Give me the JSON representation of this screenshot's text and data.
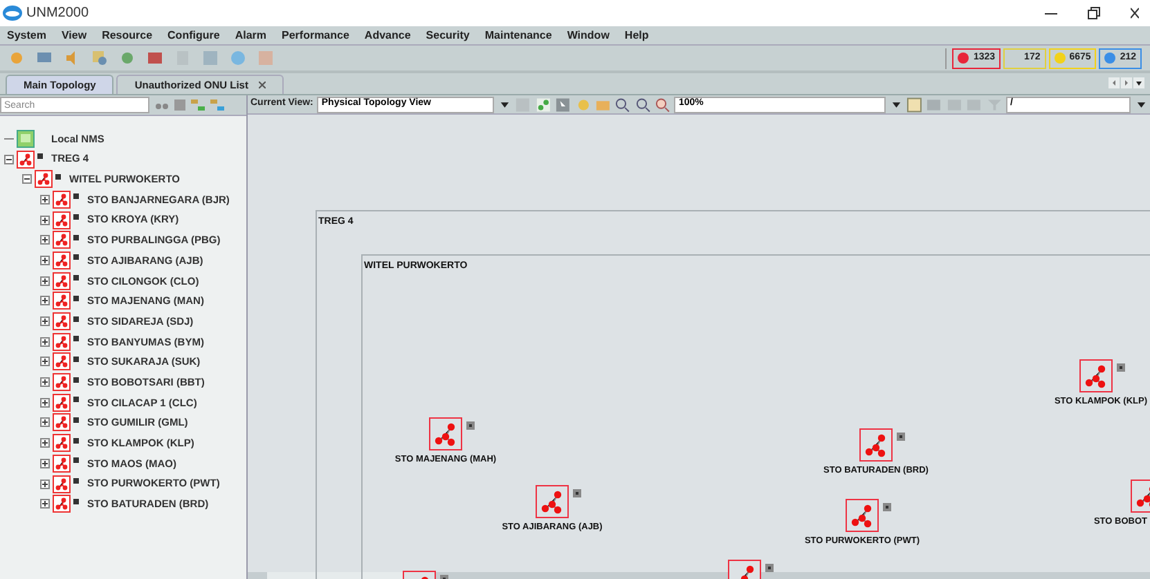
{
  "window": {
    "title": "UNM2000"
  },
  "menu": [
    "System",
    "View",
    "Resource",
    "Configure",
    "Alarm",
    "Performance",
    "Advance",
    "Security",
    "Maintenance",
    "Window",
    "Help"
  ],
  "alarm_counters": [
    {
      "count": "1323",
      "color": "#e8253a"
    },
    {
      "count": "172",
      "color": "#e0d040"
    },
    {
      "count": "6675",
      "color": "#f2d21a"
    },
    {
      "count": "212",
      "color": "#3a8ee6"
    }
  ],
  "tabs": [
    {
      "label": "Main Topology",
      "selected": true,
      "closable": false
    },
    {
      "label": "Unauthorized ONU List",
      "selected": false,
      "closable": true
    }
  ],
  "search": {
    "placeholder": "Search"
  },
  "tree": [
    {
      "label": "Local NMS",
      "kind": "nms"
    },
    {
      "label": "TREG 4",
      "kind": "group",
      "expanded": true,
      "children": [
        {
          "label": "WITEL PURWOKERTO",
          "kind": "group",
          "expanded": true,
          "children": [
            {
              "label": "STO BANJARNEGARA (BJR)",
              "kind": "group",
              "expanded": false
            },
            {
              "label": "STO KROYA (KRY)",
              "kind": "group",
              "expanded": false
            },
            {
              "label": "STO PURBALINGGA (PBG)",
              "kind": "group",
              "expanded": false
            },
            {
              "label": "STO AJIBARANG (AJB)",
              "kind": "group",
              "expanded": false
            },
            {
              "label": "STO CILONGOK (CLO)",
              "kind": "group",
              "expanded": false
            },
            {
              "label": "STO MAJENANG (MAN)",
              "kind": "group",
              "expanded": false
            },
            {
              "label": "STO SIDAREJA (SDJ)",
              "kind": "group",
              "expanded": false
            },
            {
              "label": "STO BANYUMAS (BYM)",
              "kind": "group",
              "expanded": false
            },
            {
              "label": "STO SUKARAJA (SUK)",
              "kind": "group",
              "expanded": false
            },
            {
              "label": "STO BOBOTSARI (BBT)",
              "kind": "group",
              "expanded": false
            },
            {
              "label": "STO CILACAP 1 (CLC)",
              "kind": "group",
              "expanded": false
            },
            {
              "label": "STO GUMILIR (GML)",
              "kind": "group",
              "expanded": false
            },
            {
              "label": "STO KLAMPOK (KLP)",
              "kind": "group",
              "expanded": false
            },
            {
              "label": "STO MAOS (MAO)",
              "kind": "group",
              "expanded": false
            },
            {
              "label": "STO PURWOKERTO (PWT)",
              "kind": "group",
              "expanded": false
            },
            {
              "label": "STO BATURADEN (BRD)",
              "kind": "group",
              "expanded": false
            }
          ]
        }
      ]
    }
  ],
  "view_toolbar": {
    "label": "Current View:",
    "view": "Physical Topology View",
    "zoom": "100%",
    "filter": "/"
  },
  "canvas": {
    "frames": [
      {
        "label": "TREG 4"
      },
      {
        "label": "WITEL PURWOKERTO"
      }
    ],
    "nodes": [
      {
        "kind": "labeled",
        "label": "STO MAJENANG (MAH)"
      },
      {
        "kind": "labeled",
        "label": "STO AJIBARANG (AJB)"
      },
      {
        "kind": "labeled",
        "label": "STO BATURADEN (BRD)"
      },
      {
        "kind": "labeled",
        "label": "STO PURWOKERTO (PWT)"
      },
      {
        "kind": "labeled",
        "label": "STO KLAMPOK (KLP)"
      },
      {
        "kind": "labeled",
        "label": "STO BOBOT"
      },
      {
        "kind": "icon_only"
      },
      {
        "kind": "icon_only"
      }
    ]
  }
}
